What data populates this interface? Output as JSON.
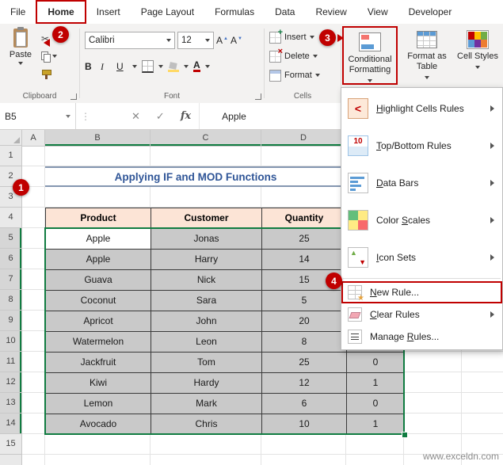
{
  "window": {
    "watermark": "www.exceldn.com"
  },
  "colors": {
    "accent_green": "#107C41",
    "annotation_red": "#C00000",
    "table_header_fill": "#FCE4D6",
    "selection_fill": "#C9C9C9",
    "title_blue": "#2F5597"
  },
  "ribbon": {
    "tabs": [
      {
        "label": "File",
        "active": false
      },
      {
        "label": "Home",
        "active": true
      },
      {
        "label": "Insert",
        "active": false
      },
      {
        "label": "Page Layout",
        "active": false
      },
      {
        "label": "Formulas",
        "active": false
      },
      {
        "label": "Data",
        "active": false
      },
      {
        "label": "Review",
        "active": false
      },
      {
        "label": "View",
        "active": false
      },
      {
        "label": "Developer",
        "active": false
      }
    ],
    "clipboard": {
      "group_label": "Clipboard",
      "paste_label": "Paste"
    },
    "font": {
      "group_label": "Font",
      "font_name": "Calibri",
      "font_size": "12",
      "bold": "B",
      "italic": "I",
      "underline": "U",
      "grow": "A",
      "shrink": "A",
      "color_letter": "A"
    },
    "cells": {
      "group_label": "Cells",
      "insert_label": "Insert",
      "delete_label": "Delete",
      "format_label": "Format"
    },
    "styles": {
      "conditional_formatting_label": "Conditional Formatting",
      "format_as_table_label": "Format as Table",
      "cell_styles_label": "Cell Styles"
    }
  },
  "formula_bar": {
    "name_box": "B5",
    "cancel_icon": "✕",
    "enter_icon": "✓",
    "fx_icon": "fx",
    "content": "Apple"
  },
  "cf_menu": {
    "items": [
      {
        "label": "Highlight Cells Rules",
        "key": "H",
        "icon": "highlight-cells",
        "submenu": true,
        "annotated": false
      },
      {
        "label": "Top/Bottom Rules",
        "key": "T",
        "icon": "top-bottom",
        "submenu": true,
        "annotated": false
      },
      {
        "label": "Data Bars",
        "key": "D",
        "icon": "data-bars",
        "submenu": true,
        "annotated": false
      },
      {
        "label": "Color Scales",
        "key": "S",
        "icon": "color-scales",
        "submenu": true,
        "annotated": false
      },
      {
        "label": "Icon Sets",
        "key": "I",
        "icon": "icon-sets",
        "submenu": true,
        "annotated": false
      },
      {
        "label": "New Rule...",
        "key": "N",
        "icon": "new-rule",
        "submenu": false,
        "annotated": true
      },
      {
        "label": "Clear Rules",
        "key": "C",
        "icon": "clear-rules",
        "submenu": true,
        "annotated": false
      },
      {
        "label": "Manage Rules...",
        "key": "R",
        "icon": "manage-rules",
        "submenu": false,
        "annotated": false
      }
    ]
  },
  "sheet": {
    "column_headers": [
      "A",
      "B",
      "C",
      "D"
    ],
    "selected_columns": [
      "B",
      "C",
      "D"
    ],
    "row_numbers": [
      "1",
      "2",
      "3",
      "4",
      "5",
      "6",
      "7",
      "8",
      "9",
      "10",
      "11",
      "12",
      "13",
      "14",
      "15"
    ],
    "selected_rows": [
      "5",
      "6",
      "7",
      "8",
      "9",
      "10",
      "11",
      "12",
      "13",
      "14"
    ],
    "title": "Applying IF and MOD Functions",
    "active_cell": "B5",
    "table": {
      "headers": [
        "Product",
        "Customer",
        "Quantity"
      ],
      "rows": [
        [
          "Apple",
          "Jonas",
          "25",
          ""
        ],
        [
          "Apple",
          "Harry",
          "14",
          ""
        ],
        [
          "Guava",
          "Nick",
          "15",
          ""
        ],
        [
          "Coconut",
          "Sara",
          "5",
          ""
        ],
        [
          "Apricot",
          "John",
          "20",
          ""
        ],
        [
          "Watermelon",
          "Leon",
          "8",
          ""
        ],
        [
          "Jackfruit",
          "Tom",
          "25",
          "0"
        ],
        [
          "Kiwi",
          "Hardy",
          "12",
          "1"
        ],
        [
          "Lemon",
          "Mark",
          "6",
          "0"
        ],
        [
          "Avocado",
          "Chris",
          "10",
          "1"
        ]
      ]
    }
  },
  "annotations": {
    "step1": "1",
    "step2": "2",
    "step3": "3",
    "step4": "4"
  }
}
